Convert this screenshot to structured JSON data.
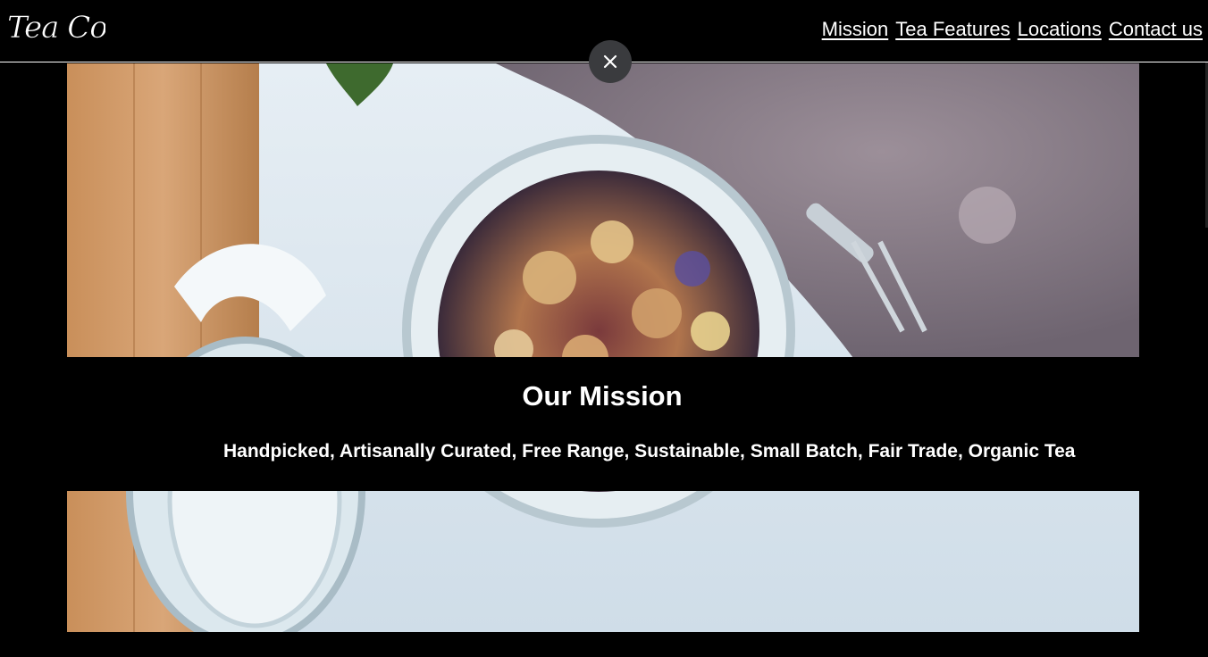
{
  "header": {
    "logo_text": "Tea Cozy",
    "nav": [
      {
        "label": "Mission"
      },
      {
        "label": "Tea Features"
      },
      {
        "label": "Locations"
      },
      {
        "label": "Contact us"
      }
    ]
  },
  "overlay": {
    "close_icon": "close-icon"
  },
  "mission": {
    "title": "Our Mission",
    "subtitle": "Handpicked, Artisanally Curated, Free Range, Sustainable, Small Batch, Fair Trade, Organic Tea"
  },
  "colors": {
    "background": "#000000",
    "text": "#ffffff",
    "close_button": "#3a3b3e"
  }
}
